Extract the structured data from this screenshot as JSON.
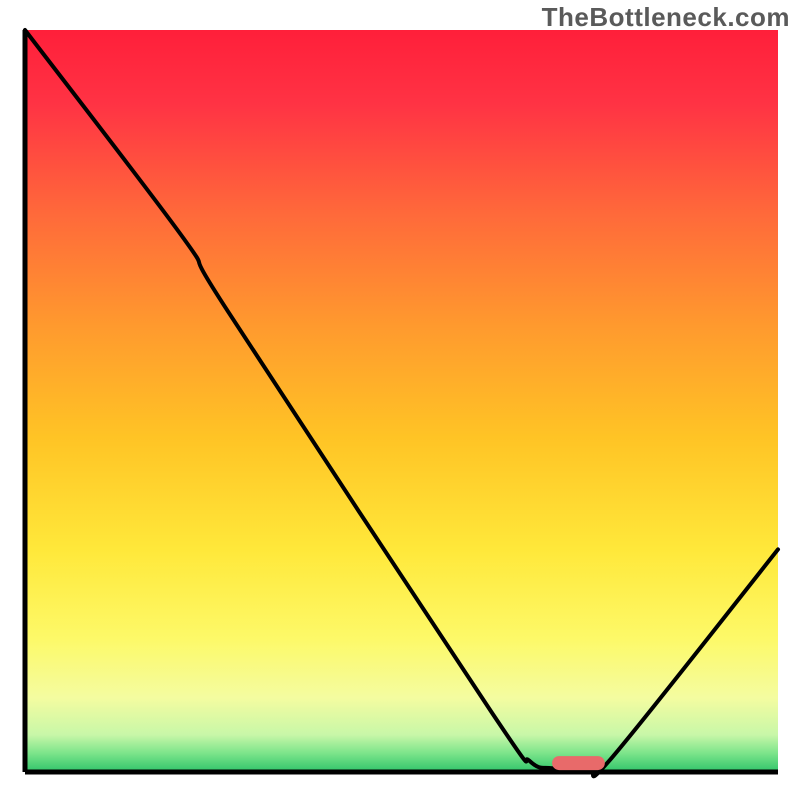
{
  "watermark": "TheBottleneck.com",
  "chart_data": {
    "type": "line",
    "title": "",
    "xlabel": "",
    "ylabel": "",
    "xlim": [
      0,
      100
    ],
    "ylim": [
      0,
      100
    ],
    "curve": [
      {
        "x": 0,
        "y": 100
      },
      {
        "x": 21,
        "y": 72
      },
      {
        "x": 27,
        "y": 62
      },
      {
        "x": 62,
        "y": 8
      },
      {
        "x": 67,
        "y": 1.5
      },
      {
        "x": 70,
        "y": 0.5
      },
      {
        "x": 75,
        "y": 0.5
      },
      {
        "x": 78,
        "y": 2
      },
      {
        "x": 100,
        "y": 30
      }
    ],
    "marker": {
      "x_start": 70,
      "x_end": 77,
      "y": 1.2,
      "color": "#e86a6a"
    },
    "gradient_stops": [
      {
        "offset": 0.0,
        "color": "#ff1f3a"
      },
      {
        "offset": 0.1,
        "color": "#ff3344"
      },
      {
        "offset": 0.25,
        "color": "#ff6a3a"
      },
      {
        "offset": 0.4,
        "color": "#ff9a2e"
      },
      {
        "offset": 0.55,
        "color": "#ffc425"
      },
      {
        "offset": 0.7,
        "color": "#ffe83a"
      },
      {
        "offset": 0.82,
        "color": "#fdf968"
      },
      {
        "offset": 0.9,
        "color": "#f4fca0"
      },
      {
        "offset": 0.95,
        "color": "#c8f7a8"
      },
      {
        "offset": 0.975,
        "color": "#7be48a"
      },
      {
        "offset": 1.0,
        "color": "#2fc46a"
      }
    ]
  }
}
